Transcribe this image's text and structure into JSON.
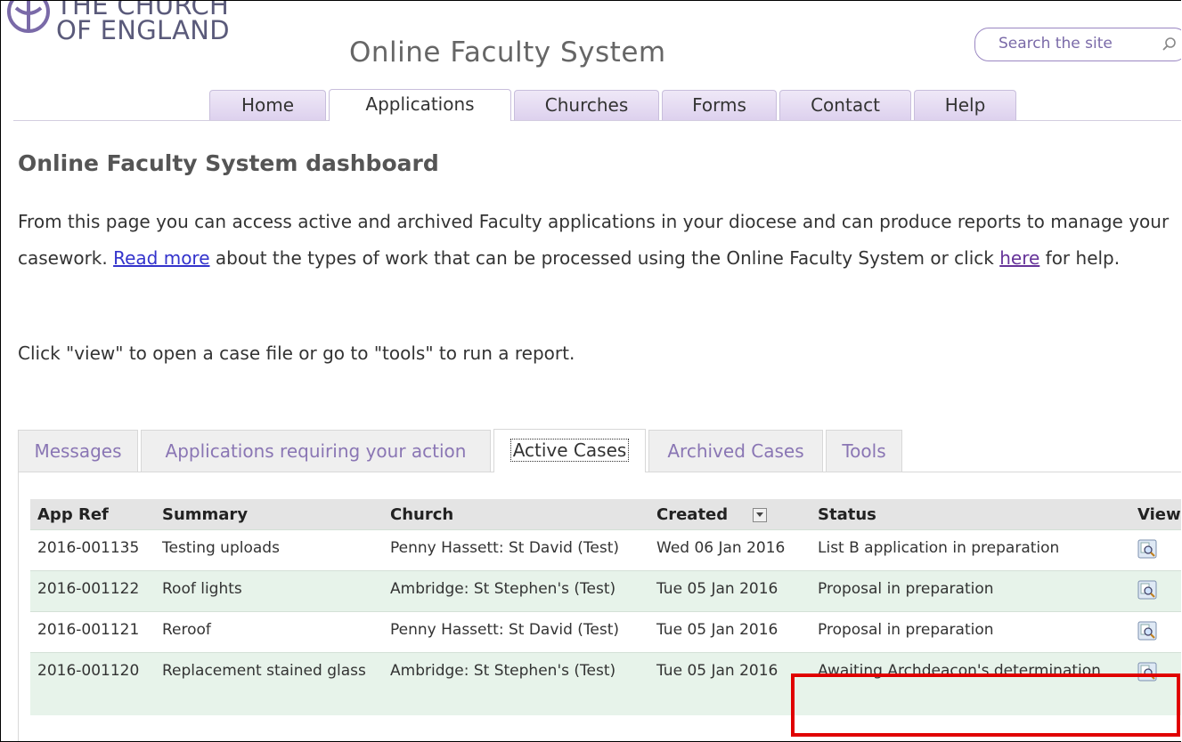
{
  "header": {
    "logo_line1": "THE CHURCH",
    "logo_line2": "OF ENGLAND",
    "site_title": "Online Faculty System",
    "search_placeholder": "Search the site"
  },
  "nav": {
    "tabs": [
      {
        "label": "Home"
      },
      {
        "label": "Applications",
        "active": true
      },
      {
        "label": "Churches"
      },
      {
        "label": "Forms"
      },
      {
        "label": "Contact"
      },
      {
        "label": "Help"
      }
    ]
  },
  "main": {
    "heading": "Online Faculty System dashboard",
    "intro_1": "From this page you can access active and archived Faculty applications in your diocese and can produce reports to manage your casework. ",
    "read_more": "Read more",
    "intro_2": " about the types of work that can be processed using the Online Faculty System or click ",
    "here": "here",
    "intro_3": " for help.",
    "instruction": "Click \"view\" to open a case file or go to \"tools\" to run a report."
  },
  "sub_tabs": [
    {
      "label": "Messages"
    },
    {
      "label": "Applications requiring your action"
    },
    {
      "label": "Active Cases",
      "active": true
    },
    {
      "label": "Archived Cases"
    },
    {
      "label": "Tools"
    }
  ],
  "table": {
    "headers": [
      "App Ref",
      "Summary",
      "Church",
      "Created",
      "Status",
      "View"
    ],
    "rows": [
      {
        "ref": "2016-001135",
        "summary": "Testing uploads",
        "church": "Penny Hassett: St David (Test)",
        "created": "Wed 06 Jan 2016",
        "status": "List B application in preparation"
      },
      {
        "ref": "2016-001122",
        "summary": "Roof lights",
        "church": "Ambridge: St Stephen's (Test)",
        "created": "Tue 05 Jan 2016",
        "status": "Proposal in preparation"
      },
      {
        "ref": "2016-001121",
        "summary": "Reroof",
        "church": "Penny Hassett: St David (Test)",
        "created": "Tue 05 Jan 2016",
        "status": "Proposal in preparation"
      },
      {
        "ref": "2016-001120",
        "summary": "Replacement stained glass",
        "church": "Ambridge: St Stephen's (Test)",
        "created": "Tue 05 Jan 2016",
        "status": "Awaiting Archdeacon's determination"
      }
    ]
  },
  "colors": {
    "accent": "#8a76b4",
    "row_alt": "#e7f3ea",
    "highlight": "#e00000"
  },
  "icons": [
    "church-cross-logo-icon",
    "search-icon",
    "sort-dropdown-icon",
    "view-magnifier-icon"
  ]
}
